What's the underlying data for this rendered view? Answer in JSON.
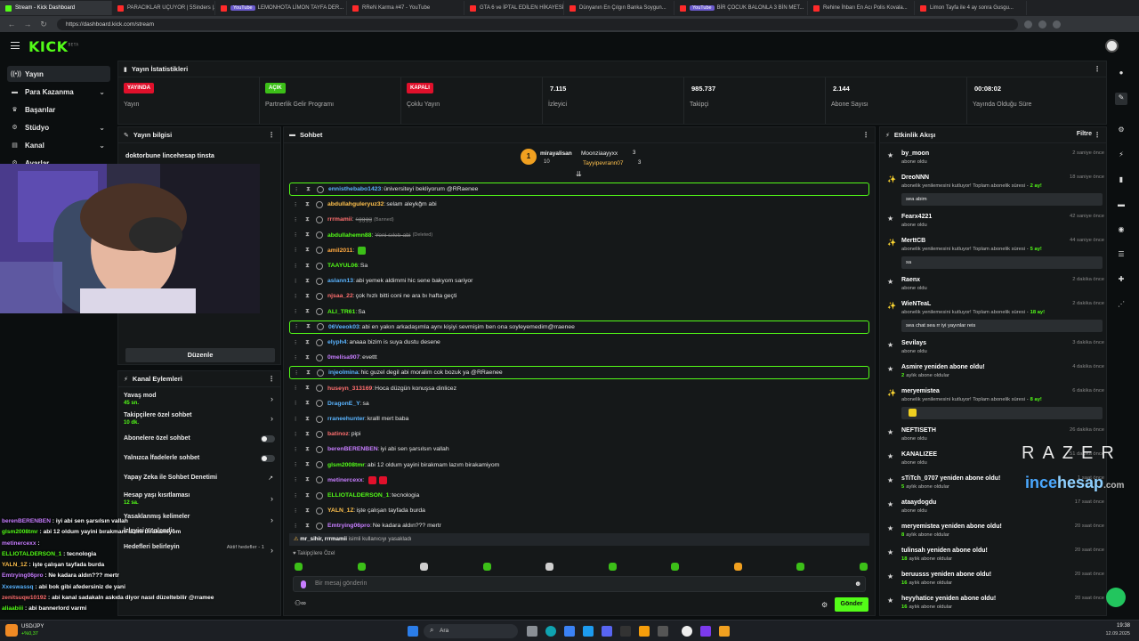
{
  "browser": {
    "tabs": [
      {
        "title": "Stream - Kick Dashboard",
        "active": true,
        "color": "#53fc18"
      },
      {
        "title": "PARACIKLAR UÇUYOR | 5Sinders |...",
        "color": "#ff2a2a"
      },
      {
        "title": "LEMONHOTA LİMON TAYFA DER...",
        "badge": "YouTube",
        "color": "#ff2a2a"
      },
      {
        "title": "RReN Karma #47 - YouTube",
        "color": "#ff2a2a"
      },
      {
        "title": "GTA 6 ve İPTAL EDİLEN HİKAYESİ...",
        "color": "#ff2a2a"
      },
      {
        "title": "Dünyanın En Çılgın Banka Soygun...",
        "color": "#ff2a2a"
      },
      {
        "title": "BİR ÇOCUK BALONLA 3 BİN MET...",
        "badge": "YouTube",
        "color": "#ff2a2a"
      },
      {
        "title": "Rehine İhbarı En Acı Polis Kovala...",
        "color": "#ff2a2a"
      },
      {
        "title": "Limon Tayfa ile 4 ay sonra Gusgu...",
        "color": "#ff2a2a"
      }
    ],
    "url": "https://dashboard.kick.com/stream"
  },
  "brand": {
    "logo": "KICK",
    "beta": "BETA",
    "accent": "#53fc18"
  },
  "sidebar": {
    "items": [
      {
        "label": "Yayın",
        "icon": "broadcast-icon",
        "active": true
      },
      {
        "label": "Para Kazanma",
        "icon": "money-icon",
        "chevron": true
      },
      {
        "label": "Başarılar",
        "icon": "trophy-icon"
      },
      {
        "label": "Stüdyo",
        "icon": "studio-icon",
        "chevron": true
      },
      {
        "label": "Kanal",
        "icon": "channel-icon",
        "chevron": true
      },
      {
        "label": "Ayarlar",
        "icon": "gear-icon"
      }
    ]
  },
  "stats": {
    "title": "Yayın İstatistikleri",
    "cards": [
      {
        "badge": "YAYINDA",
        "label": "Yayın",
        "color": "#e0102b"
      },
      {
        "badge": "AÇIK",
        "label": "Partnerlik Gelir Programı",
        "color": "#3cbf18"
      },
      {
        "badge": "KAPALI",
        "label": "Çoklu Yayın",
        "color": "#e0102b"
      },
      {
        "value": "7.115",
        "label": "İzleyici"
      },
      {
        "value": "985.737",
        "label": "Takipçi"
      },
      {
        "value": "2.144",
        "label": "Abone Sayısı"
      },
      {
        "value": "00:08:02",
        "label": "Yayında Olduğu Süre"
      }
    ]
  },
  "stream_info": {
    "title": "Yayın bilgisi",
    "stream_title": "doktorbune lincehesap tinsta",
    "edit_button": "Düzenle"
  },
  "channel_actions": {
    "title": "Kanal Eylemleri",
    "items": [
      {
        "label": "Yavaş mod",
        "sub": "45 sn.",
        "control": "chevron"
      },
      {
        "label": "Takipçilere özel sohbet",
        "sub": "10 dk.",
        "control": "chevron"
      },
      {
        "label": "Abonelere özel sohbet",
        "control": "toggle"
      },
      {
        "label": "Yalnızca İfadelerle sohbet",
        "control": "toggle"
      },
      {
        "label": "Yapay Zeka ile Sohbet Denetimi",
        "control": "external"
      },
      {
        "label": "Hesap yaşı kısıtlaması",
        "sub": "12 sa.",
        "control": "chevron"
      },
      {
        "label": "Yasaklanmış kelimeler",
        "control": "chevron"
      },
      {
        "label": "İzleyici Yönlendir",
        "control": "none"
      },
      {
        "label": "Hedefleri belirleyin",
        "status": "Aktif hedefler - 1",
        "control": "chevron"
      }
    ]
  },
  "chat": {
    "title": "Sohbet",
    "leaderboard": [
      {
        "rank": "1",
        "name": "mirayalisan",
        "count": "10"
      },
      {
        "name": "Moonziaayyxx",
        "count": "3"
      },
      {
        "name": "Tayyipevrann07",
        "count": "3"
      }
    ],
    "messages": [
      {
        "user": "ennisthebabo1423",
        "text": "üniversiteyi bekliyorum @RRaenee",
        "color": "#5ab4ff",
        "hl": true
      },
      {
        "user": "abdullahguleryuz32",
        "text": "selam aleykğm abi",
        "color": "#ffc14d"
      },
      {
        "user": "rrrmamii",
        "deleted": "sgggg",
        "tag": "(Banned)",
        "color": "#ff6f6f"
      },
      {
        "user": "abdullahemn88",
        "deleted": "Yeni sıkıtı abi",
        "tag": "(Deleted)",
        "color": "#53fc18"
      },
      {
        "user": "amil2011",
        "text": "",
        "emote": "#3cbf18",
        "color": "#ffa940"
      },
      {
        "user": "TAAYUL06",
        "text": "Sa",
        "color": "#53fc18"
      },
      {
        "user": "aslann13",
        "text": "abi yemek aldimmi hic sene bakyom sariyor",
        "color": "#5ab4ff"
      },
      {
        "user": "njsaa_22",
        "text": "çok hızlı bitti coni ne ara bı hafta geçti",
        "color": "#ff6f6f"
      },
      {
        "user": "ALI_TR61",
        "text": "Sa",
        "color": "#53fc18"
      },
      {
        "user": "06Veeok03",
        "text": "abi en yakın arkadaşımla aynı kişiyi sevmişim ben ona soyleyemedim@rraenee",
        "color": "#5ab4ff",
        "hl": true
      },
      {
        "user": "elyph4",
        "text": "anaaa bizim is suya dustu desene",
        "color": "#5ab4ff"
      },
      {
        "user": "0melisa907",
        "text": "evettt",
        "color": "#c77dff"
      },
      {
        "user": "injeolmina",
        "text": "hic guzel degil abi moralim cok bozuk ya @RRaenee",
        "color": "#5ab4ff",
        "hl": true
      },
      {
        "user": "huseyn_313169",
        "text": "Hoca düzgün konuşsa dinlicez",
        "color": "#ff6f6f"
      },
      {
        "user": "DragonE_Y",
        "text": "sa",
        "color": "#5ab4ff"
      },
      {
        "user": "rraneehunter",
        "text": "kralll mert baba",
        "color": "#5ab4ff"
      },
      {
        "user": "batinoz",
        "text": "pipi",
        "color": "#ff6f6f"
      },
      {
        "user": "berenBERENBEN",
        "text": "iyi abi sen şarsılsın vallah",
        "color": "#c77dff"
      },
      {
        "user": "glsm2008tmr",
        "text": "abi 12 oldum yayini birakmam lazım birakamiyom",
        "color": "#53fc18"
      },
      {
        "user": "metinercexx",
        "text": "",
        "emote": "#e0102b",
        "emote2": "#e0102b",
        "color": "#c77dff"
      },
      {
        "user": "ELLIOTALDERSON_1",
        "text": "tecnologia",
        "color": "#53fc18"
      },
      {
        "user": "YALN_1Z",
        "text": "işte çalışan tayfada burda",
        "color": "#ffc14d"
      },
      {
        "user": "Emtrying06pro",
        "text": "Ne kadara aldın??? mertr",
        "color": "#c77dff"
      }
    ],
    "ban_notice_users": "mr_sihir, rrrmamii",
    "ban_notice_text": "isimli kullanıcıyı yasakladı",
    "emotes_label": "Takipçilere Özel",
    "input_placeholder": "Bir mesaj gönderin",
    "send_button": "Gönder"
  },
  "activity": {
    "title": "Etkinlik Akışı",
    "filter": "Filtre",
    "events": [
      {
        "name": "by_moon",
        "sub": "abone oldu",
        "time": "2 saniye önce",
        "icon": "star-icon"
      },
      {
        "name": "DreoNNN",
        "sub": "abonelik yenilemesini kutluyor! Toplam abonelik süresi -",
        "months": "2 ay!",
        "time": "18 saniye önce",
        "icon": "party-icon",
        "box": "sea abim"
      },
      {
        "name": "Fearx4221",
        "sub": "abone oldu",
        "time": "42 saniye önce",
        "icon": "star-icon"
      },
      {
        "name": "MerttCB",
        "sub": "abonelik yenilemesini kutluyor! Toplam abonelik süresi -",
        "months": "5 ay!",
        "time": "44 saniye önce",
        "icon": "party-icon",
        "box": "sa"
      },
      {
        "name": "Raenx",
        "sub": "abone oldu",
        "time": "2 dakika önce",
        "icon": "star-icon"
      },
      {
        "name": "WieNTeaL",
        "sub": "abonelik yenilemesini kutluyor! Toplam abonelik süresi -",
        "months": "18 ay!",
        "time": "2 dakika önce",
        "icon": "party-icon",
        "box": "sea chat sea rr iyi yayınlar reis"
      },
      {
        "name": "Sevilays",
        "sub": "abone oldu",
        "time": "3 dakika önce",
        "icon": "star-icon"
      },
      {
        "name": "Asmire yeniden abone oldu!",
        "sub": "aylık abone oldular",
        "months": "2",
        "time": "4 dakika önce",
        "icon": "star-icon"
      },
      {
        "name": "meryemistea",
        "sub": "abonelik yenilemesini kutluyor! Toplam abonelik süresi -",
        "months": "8 ay!",
        "time": "6 dakika önce",
        "icon": "party-icon",
        "emotebox": true
      },
      {
        "name": "NEFTISETH",
        "sub": "abone oldu",
        "time": "26 dakika önce",
        "icon": "star-icon"
      },
      {
        "name": "KANALIZEE",
        "sub": "abone oldu",
        "time": "51 dakika önce",
        "icon": "star-icon"
      },
      {
        "name": "sTiTch_0707 yeniden abone oldu!",
        "sub": "aylık abone oldular",
        "months": "5",
        "time": "1 saat önce",
        "icon": "star-icon"
      },
      {
        "name": "ataaydogdu",
        "sub": "abone oldu",
        "time": "17 saat önce",
        "icon": "star-icon"
      },
      {
        "name": "meryemistea yeniden abone oldu!",
        "sub": "aylık abone oldular",
        "months": "8",
        "time": "20 saat önce",
        "icon": "star-icon"
      },
      {
        "name": "tulinsah yeniden abone oldu!",
        "sub": "aylık abone oldular",
        "months": "18",
        "time": "20 saat önce",
        "icon": "star-icon"
      },
      {
        "name": "beruusss yeniden abone oldu!",
        "sub": "aylık abone oldular",
        "months": "16",
        "time": "20 saat önce",
        "icon": "star-icon"
      },
      {
        "name": "heyyhatice yeniden abone oldu!",
        "sub": "aylık abone oldular",
        "months": "16",
        "time": "20 saat önce",
        "icon": "star-icon"
      }
    ]
  },
  "overlay_chat": [
    {
      "user": "berenBERENBEN",
      "text": "iyi abi sen şarsılsın vallah",
      "color": "#c77dff"
    },
    {
      "user": "glsm2008tmr",
      "text": "abi 12 oldum yayini bırakmam lazım birakamiyom",
      "color": "#53fc18"
    },
    {
      "user": "metinercexx",
      "text": "",
      "color": "#c77dff"
    },
    {
      "user": "ELLIOTALDERSON_1",
      "text": "tecnologia",
      "color": "#53fc18"
    },
    {
      "user": "YALN_1Z",
      "text": "işte çalışan tayfada burda",
      "color": "#ffc14d"
    },
    {
      "user": "Emtrying06pro",
      "text": "Ne kadara aldın??? mertr",
      "color": "#c77dff"
    },
    {
      "user": "Xxeswassq",
      "text": "abi bok gibi afedersiniz de yani",
      "color": "#5ab4ff"
    },
    {
      "user": "zenitsuqw10192",
      "text": "abi kanal sadakaln askıda diyor nasıl düzeltebilir @rramee",
      "color": "#ff6f6f"
    },
    {
      "user": "aliaabiii",
      "text": "abi bannerlord varmi",
      "color": "#53fc18"
    }
  ],
  "watermark": {
    "brand": "RAZER",
    "site_a": "ince",
    "site_b": "hesap",
    "site_c": ".com"
  },
  "taskbar": {
    "ticker_name": "USD/JPY",
    "ticker_change": "+%0,37",
    "search_placeholder": "Ara",
    "time": "19:38",
    "date": "12.09.2025"
  }
}
